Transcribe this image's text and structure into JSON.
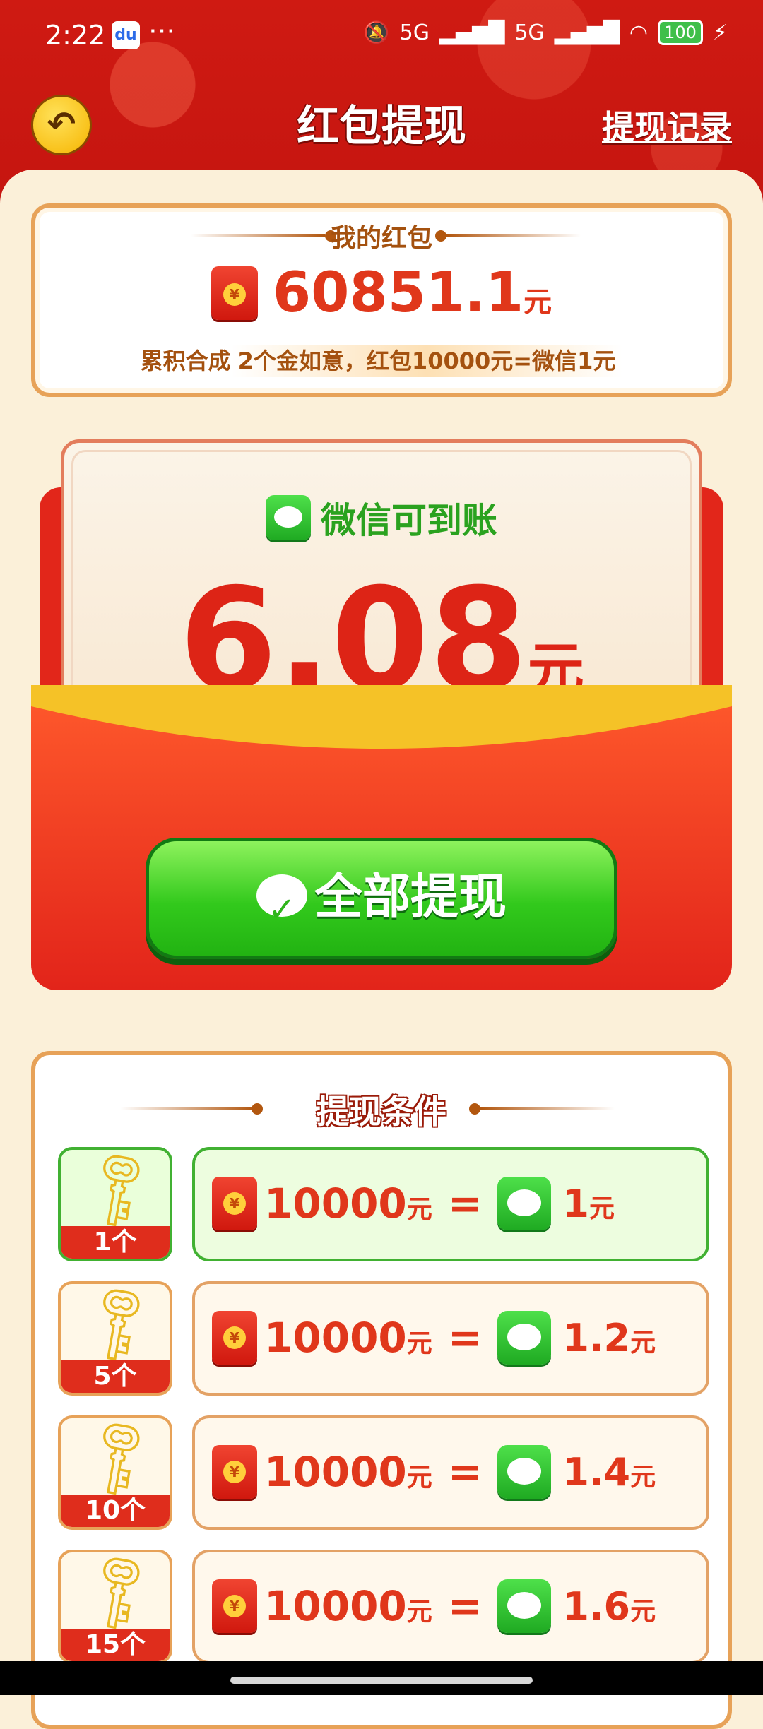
{
  "status_bar": {
    "time": "2:22",
    "app_badge": "du",
    "more": "···",
    "signal_1": "5G",
    "signal_2": "5G",
    "battery": "100"
  },
  "header": {
    "back_icon": "back-arrow-icon",
    "title": "红包提现",
    "records_label": "提现记录"
  },
  "balance": {
    "label": "我的红包",
    "amount": "60851.1",
    "unit": "元",
    "rule_prefix": "累积合成",
    "rule_highlight": "2个金如意，红包10000元=微信1元"
  },
  "withdraw": {
    "wechat_label": "微信可到账",
    "amount": "6.08",
    "unit": "元",
    "button_label": "全部提现"
  },
  "conditions": {
    "title": "提现条件",
    "rows": [
      {
        "count": "1个",
        "from": "10000",
        "from_unit": "元",
        "eq": "=",
        "to": "1",
        "to_unit": "元"
      },
      {
        "count": "5个",
        "from": "10000",
        "from_unit": "元",
        "eq": "=",
        "to": "1.2",
        "to_unit": "元"
      },
      {
        "count": "10个",
        "from": "10000",
        "from_unit": "元",
        "eq": "=",
        "to": "1.4",
        "to_unit": "元"
      },
      {
        "count": "15个",
        "from": "10000",
        "from_unit": "元",
        "eq": "=",
        "to": "1.6",
        "to_unit": "元"
      }
    ]
  },
  "colors": {
    "brand_red": "#e0371b",
    "wechat_green": "#2fb51c",
    "border_orange": "#e7a258"
  }
}
